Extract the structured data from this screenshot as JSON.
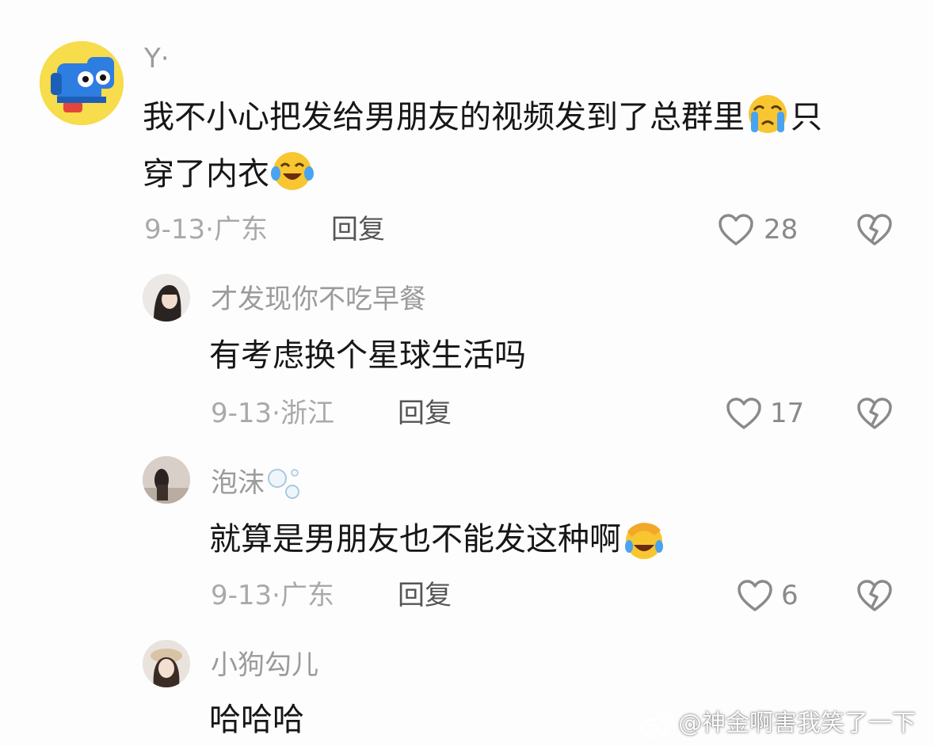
{
  "colors": {
    "background": "#fdfdfd",
    "username": "#9b9b9b",
    "meta": "#a9a9a9",
    "icon": "#8a8a8a"
  },
  "comment": {
    "username": "Y·",
    "text_line1": "我不小心把发给男朋友的视频发到了总群里",
    "text_line1_end": "只",
    "text_line2": "穿了内衣",
    "date": "9-13·",
    "location": "广东",
    "reply_label": "回复",
    "likes": "28"
  },
  "replies": [
    {
      "username": "才发现你不吃早餐",
      "text": "有考虑换个星球生活吗",
      "date": "9-13·",
      "location": "浙江",
      "reply_label": "回复",
      "likes": "17"
    },
    {
      "username": "泡沫",
      "text": "就算是男朋友也不能发这种啊",
      "date": "9-13·",
      "location": "广东",
      "reply_label": "回复",
      "likes": "6"
    },
    {
      "username": "小狗勾儿",
      "text": "哈哈哈"
    }
  ],
  "watermark": "@神金啊害我笑了一下",
  "icons": {
    "like": "heart-outline-icon",
    "dislike": "broken-heart-icon",
    "weibo": "weibo-logo-icon",
    "crying_emoji": "crying-face-emoji",
    "tears_of_joy_emoji": "tears-of-joy-emoji",
    "facepalm_emoji": "facepalm-laugh-emoji",
    "bubbles": "bubbles-icon"
  }
}
